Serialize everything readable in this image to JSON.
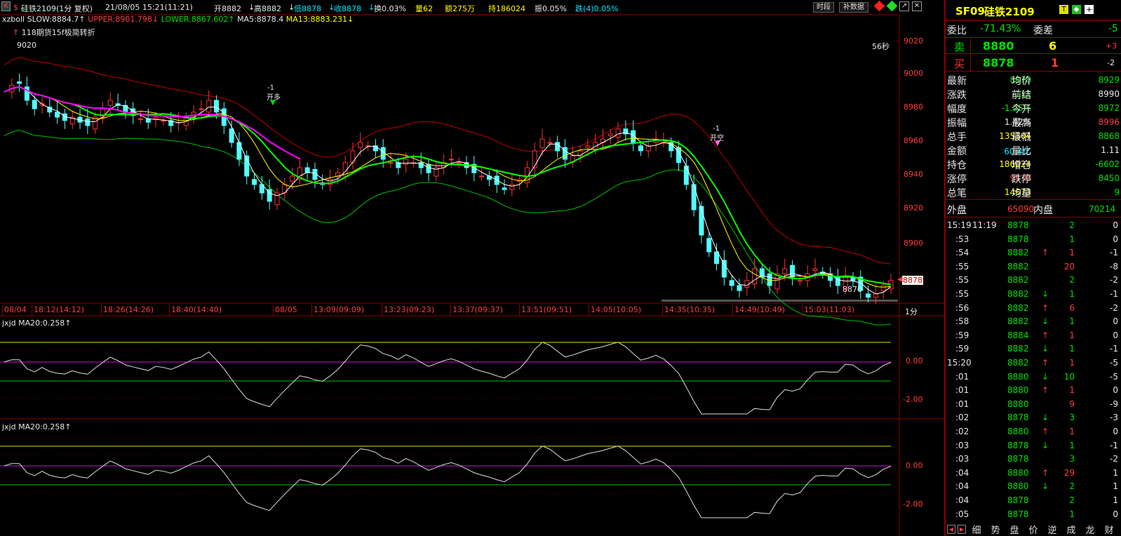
{
  "header": {
    "k_label": "K",
    "s_label": "$",
    "title": "硅铁2109(1分 复权)",
    "datetime": "21/08/05 15:21(11:21)",
    "open": "开8882",
    "open_arrow": "↓",
    "high": "高8882",
    "high_arrow": "↓",
    "low": "低8878",
    "low_arrow": "↓",
    "close": "收8878",
    "close_arrow": "↓",
    "turnover": "换0.03%",
    "volume": "量62",
    "amount": "额275万",
    "hold": "持186024",
    "amplitude": "振0.05%",
    "change": "跌(4)0.05%",
    "btn_period": "时段",
    "btn_fill": "补数据"
  },
  "indicator": {
    "name": "xzboll",
    "slow": "SLOW:8884.7↑",
    "upper": "UPPER:8901.798↓",
    "lower": "LOWER:8867.602↑",
    "ma5": "MA5:8878.4",
    "ma13": "MA13:8883.231↓"
  },
  "notes": {
    "signal_note": "118期货15f极简转折",
    "countdown": "56秒",
    "peak_label": "9020",
    "low_label": "8870",
    "open_long": "开多",
    "open_long_num": "-1",
    "open_short": "开空",
    "open_short_num": "-1",
    "current_price": "8878",
    "period": "1分"
  },
  "axis": {
    "price_ticks": [
      "9020",
      "9000",
      "8980",
      "8960",
      "8940",
      "8920",
      "8900"
    ],
    "time_labels": [
      "08/04",
      "18:12(14:12)",
      "18:26(14:26)",
      "18:40(14:40)",
      "08/05",
      "13:09(09:09)",
      "13:23(09:23)",
      "13:37(09:37)",
      "13:51(09:51)",
      "14:05(10:05)",
      "14:35(10:35)",
      "14:49(10:49)",
      "15:03(11:03)"
    ],
    "osc_ticks": [
      "0.00",
      "-2.00"
    ]
  },
  "sub1": {
    "label": "jxjd MA20:0.258↑"
  },
  "sub2": {
    "label": "jxjd MA20:0.258↑"
  },
  "quote": {
    "code": "SF09",
    "name": "硅铁2109",
    "wb_label": "委比",
    "wb_value": "-71.43%",
    "wc_label": "委差",
    "wc_value": "-5",
    "sell_label": "卖",
    "sell_price": "8880",
    "sell_vol": "6",
    "sell_chg": "+3",
    "buy_label": "买",
    "buy_price": "8878",
    "buy_vol": "1",
    "buy_chg": "-2",
    "stats": [
      [
        "最新",
        "8878",
        "均价",
        "8929"
      ],
      [
        "涨跌",
        "-112",
        "前结",
        "8990"
      ],
      [
        "幅度",
        "-1.25%",
        "今开",
        "8972"
      ],
      [
        "振幅",
        "1.42%",
        "最高",
        "8996"
      ],
      [
        "总手",
        "135304",
        "最低",
        "8868"
      ],
      [
        "金额",
        "60.4亿",
        "量比",
        "1.11"
      ],
      [
        "持仓",
        "186024",
        "增仓",
        "-6602"
      ],
      [
        "涨停",
        "9530",
        "跌停",
        "8450"
      ],
      [
        "总笔",
        "14673",
        "均量",
        "9"
      ]
    ],
    "outer_label": "外盘",
    "outer_value": "65090",
    "inner_label": "内盘",
    "inner_value": "70214"
  },
  "ticks": [
    [
      "15:19",
      "11:19",
      "8878",
      "",
      "2",
      "0"
    ],
    [
      "",
      ":53",
      "8878",
      "",
      "1",
      "0"
    ],
    [
      "",
      ":54",
      "8882",
      "↑",
      "1",
      "-1"
    ],
    [
      "",
      ":55",
      "8882",
      "",
      "20",
      "-8"
    ],
    [
      "",
      ":55",
      "8882",
      "",
      "2",
      "-2"
    ],
    [
      "",
      ":55",
      "8882",
      "↓",
      "1",
      "-1"
    ],
    [
      "",
      ":56",
      "8882",
      "↑",
      "6",
      "-2"
    ],
    [
      "",
      ":58",
      "8882",
      "↓",
      "1",
      "0"
    ],
    [
      "",
      ":59",
      "8884",
      "↑",
      "1",
      "0"
    ],
    [
      "",
      ":59",
      "8882",
      "↓",
      "1",
      "-1"
    ],
    [
      "15:20",
      "",
      "8882",
      "↑",
      "1",
      "-5"
    ],
    [
      "",
      ":01",
      "8880",
      "↓",
      "10",
      "-5"
    ],
    [
      "",
      ":01",
      "8880",
      "↑",
      "1",
      "0"
    ],
    [
      "",
      ":01",
      "8880",
      "",
      "9",
      "-9"
    ],
    [
      "",
      ":02",
      "8878",
      "↓",
      "3",
      "-3"
    ],
    [
      "",
      ":02",
      "8880",
      "↑",
      "1",
      "0"
    ],
    [
      "",
      ":03",
      "8878",
      "↓",
      "1",
      "-1"
    ],
    [
      "",
      ":03",
      "8878",
      "",
      "3",
      "-2"
    ],
    [
      "",
      ":04",
      "8880",
      "↑",
      "29",
      "1"
    ],
    [
      "",
      ":04",
      "8880",
      "↓",
      "2",
      "1"
    ],
    [
      "",
      ":04",
      "8878",
      "",
      "2",
      "1"
    ],
    [
      "",
      ":05",
      "8878",
      "",
      "1",
      "0"
    ]
  ],
  "tabs": [
    "细",
    "势",
    "盘",
    "价",
    "逆",
    "成",
    "龙",
    "财"
  ],
  "series_seed": [
    8990,
    8994,
    8995,
    8985,
    8980,
    8983,
    8978,
    8975,
    8973,
    8975,
    8972,
    8970,
    8975,
    8980,
    8985,
    8982,
    8978,
    8976,
    8974,
    8972,
    8975,
    8973,
    8970,
    8972,
    8975,
    8978,
    8980,
    8985,
    8978,
    8970,
    8960,
    8950,
    8940,
    8935,
    8930,
    8925,
    8930,
    8935,
    8940,
    8945,
    8942,
    8938,
    8935,
    8938,
    8942,
    8948,
    8955,
    8960,
    8958,
    8955,
    8950,
    8948,
    8945,
    8950,
    8948,
    8945,
    8942,
    8945,
    8948,
    8950,
    8948,
    8945,
    8942,
    8940,
    8938,
    8935,
    8932,
    8935,
    8938,
    8945,
    8955,
    8962,
    8960,
    8955,
    8950,
    8952,
    8955,
    8958,
    8960,
    8962,
    8965,
    8968,
    8965,
    8960,
    8955,
    8958,
    8962,
    8960,
    8955,
    8948,
    8935,
    8920,
    8905,
    8895,
    8888,
    8880,
    8875,
    8872,
    8878,
    8885,
    8880,
    8875,
    8882,
    8885,
    8880,
    8878,
    8882,
    8885,
    8882,
    8878,
    8875,
    8880,
    8878,
    8872,
    8868,
    8870,
    8875,
    8878
  ]
}
